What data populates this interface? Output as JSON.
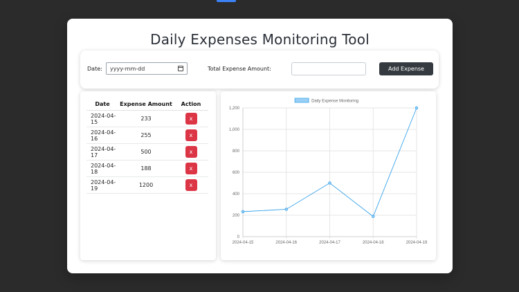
{
  "page": {
    "title": "Daily Expenses Monitoring Tool"
  },
  "form": {
    "date_label": "Date:",
    "date_placeholder": "yyyy-mm-dd",
    "total_label": "Total Expense Amount:",
    "amount_value": "",
    "add_button_label": "Add Expense"
  },
  "table": {
    "headers": [
      "Date",
      "Expense Amount",
      "Action"
    ],
    "rows": [
      {
        "date": "2024-04-15",
        "amount": "233",
        "action": "x"
      },
      {
        "date": "2024-04-16",
        "amount": "255",
        "action": "x"
      },
      {
        "date": "2024-04-17",
        "amount": "500",
        "action": "x"
      },
      {
        "date": "2024-04-18",
        "amount": "188",
        "action": "x"
      },
      {
        "date": "2024-04-19",
        "amount": "1200",
        "action": "x"
      }
    ]
  },
  "chart_data": {
    "type": "line",
    "title": "",
    "xlabel": "",
    "ylabel": "",
    "categories": [
      "2024-04-15",
      "2024-04-16",
      "2024-04-17",
      "2024-04-18",
      "2024-04-19"
    ],
    "series": [
      {
        "name": "Daily Expense Monitoring",
        "values": [
          233,
          255,
          500,
          188,
          1200
        ]
      }
    ],
    "ylim": [
      0,
      1200
    ],
    "yticks": [
      "0",
      "200",
      "400",
      "600",
      "800",
      "1,000",
      "1,200"
    ],
    "grid": true,
    "legend": "top-center",
    "colors": {
      "line": "#36a2eb",
      "legend_fill": "#9ad0f5",
      "grid": "#e5e5e5"
    }
  },
  "colors": {
    "background": "#2b2b2b",
    "card": "#ffffff",
    "primary_button": "#343a40",
    "danger_button": "#dc3545"
  }
}
